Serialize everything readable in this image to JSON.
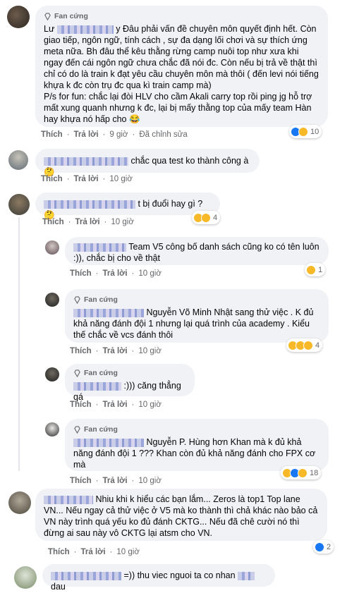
{
  "comments": [
    {
      "fan_badge": "Fan cứng",
      "prefix": "Lư",
      "text": "y Đâu phải vấn đề chuyên môn quyết định hết. Còn giao tiếp, ngôn ngữ, tính cách , sự đa dạng lối chơi và sự thích ứng meta nữa. Bh đâu thể kêu thằng rừng camp nuôi top như xưa khi ngay đến cái ngôn ngữ chưa chắc đã nói đc. Còn nếu bị trả về thật thì chỉ có do là train k đạt yêu cầu chuyên môn mà thôi ( đến levi nói tiếng khựa k đc còn trụ đc qua kì train camp mà)",
      "text2": "P/s for fun: chắc lại đòi HLV cho cầm Akali carry top rồi ping jg hỗ trợ mất xung quanh nhưng k đc, lại bị mấy thằng top của mấy team Hàn hay khựa nó hấp cho 😂",
      "like": "Thích",
      "reply": "Trả lời",
      "time": "9 giờ",
      "edited": "Đã chỉnh sửa",
      "count": "10"
    },
    {
      "text": "chắc qua test ko thành công à 🤔",
      "like": "Thích",
      "reply": "Trả lời",
      "time": "10 giờ"
    },
    {
      "text": "t bị đuổi hay gì ? 🤔",
      "like": "Thích",
      "reply": "Trả lời",
      "time": "10 giờ",
      "count": "4"
    },
    {
      "text": "Team V5 công bố danh sách cũng ko có tên luôn :)), chắc bị cho về thật",
      "like": "Thích",
      "reply": "Trả lời",
      "time": "10 giờ",
      "count": "1"
    },
    {
      "fan_badge": "Fan cứng",
      "text": "Nguyễn Võ Minh Nhật sang thử việc . K đủ khả năng đánh đội 1 nhưng lại quá trình của academy . Kiểu thế chắc về vcs đánh thôi",
      "like": "Thích",
      "reply": "Trả lời",
      "time": "10 giờ",
      "count": "4"
    },
    {
      "fan_badge": "Fan cứng",
      "text": ":))) căng thẳng qá",
      "like": "Thích",
      "reply": "Trả lời",
      "time": "10 giờ"
    },
    {
      "fan_badge": "Fan cứng",
      "text": "Nguyễn P. Hùng hơn Khan mà k đủ khả năng đánh đội 1 ??? Khan còn đủ khả năng đánh cho FPX cơ mà",
      "like": "Thích",
      "reply": "Trả lời",
      "time": "10 giờ",
      "count": "18"
    },
    {
      "text": "Nhiu khi k hiểu các bạn lắm... Zeros là top1 Top lane VN... Nếu ngay cả thử việc ở V5 mà ko thành thì chả khác nào bảo cả VN này trình quá yếu ko đủ đánh CKTG... Nếu đã chê cười nó thì đừng ai sau này vô CKTG lại atsm cho VN.",
      "like": "Thích",
      "reply": "Trả lời",
      "time": "10 giờ",
      "count": "2"
    },
    {
      "text": "=)) thu viec nguoi ta co nhan",
      "text_tail": "dau"
    }
  ],
  "icons": [
    "diamond-icon",
    "like-reaction-icon",
    "haha-reaction-icon",
    "wow-reaction-icon"
  ],
  "colors": {
    "bubble": "#f0f2f5",
    "meta_text": "#65676b",
    "like_blue": "#1877f2",
    "haha_yellow": "#f7b928"
  }
}
